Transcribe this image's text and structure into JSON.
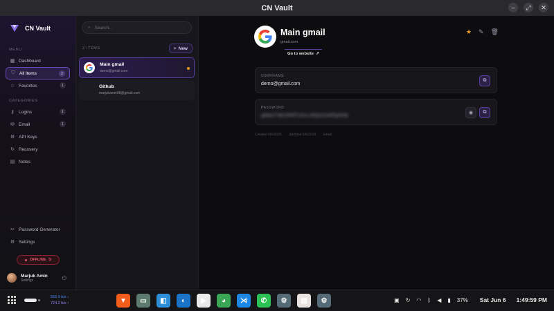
{
  "window": {
    "title": "CN Vault",
    "controls": [
      "–",
      "⤢",
      "✕"
    ]
  },
  "sidebar": {
    "brand": "CN Vault",
    "menu_label": "MENU",
    "menu": [
      {
        "label": "Dashboard",
        "icon": "dashboard-icon",
        "glyph": "▦",
        "count": ""
      },
      {
        "label": "All Items",
        "icon": "shield-icon",
        "glyph": "⛉",
        "count": "2"
      },
      {
        "label": "Favorites",
        "icon": "star-icon",
        "glyph": "☆",
        "count": "1"
      }
    ],
    "categories_label": "CATEGORIES",
    "categories": [
      {
        "label": "Logins",
        "icon": "key-icon",
        "glyph": "⚷",
        "count": "1"
      },
      {
        "label": "Email",
        "icon": "mail-icon",
        "glyph": "✉",
        "count": "1"
      },
      {
        "label": "API Keys",
        "icon": "api-icon",
        "glyph": "⚙",
        "count": ""
      },
      {
        "label": "Recovery",
        "icon": "recovery-icon",
        "glyph": "↻",
        "count": ""
      },
      {
        "label": "Notes",
        "icon": "note-icon",
        "glyph": "▤",
        "count": ""
      }
    ],
    "bottom": [
      {
        "label": "Password Generator",
        "icon": "tools-icon",
        "glyph": "✂"
      },
      {
        "label": "Settings",
        "icon": "gear-icon",
        "glyph": "⚙"
      }
    ],
    "status": "OFFLINE",
    "user": {
      "name": "Marjuk Amin",
      "sub": "Settings"
    }
  },
  "list": {
    "search_placeholder": "Search...",
    "count_label": "2 ITEMS",
    "new_label": "New",
    "items": [
      {
        "title": "Main gmail",
        "sub": "demo@gmail.com"
      },
      {
        "title": "Github",
        "sub": "marjukamin98@gmail.com"
      }
    ]
  },
  "detail": {
    "title": "Main gmail",
    "domain": "gmail.com",
    "goto_label": "Go to website",
    "username_label": "USERNAME",
    "username": "demo@gmail.com",
    "password_label": "PASSWORD",
    "password_masked": "gMail7!dK2f#9Tz4vLx8Qw2mR5pN3b",
    "created": "Created 6/6/2025",
    "updated": "Updated 6/6/2025",
    "category": "Email"
  },
  "taskbar": {
    "net_down": "555.9  b/s",
    "net_up": "724.2  b/s",
    "apps": [
      {
        "name": "brave-browser-icon",
        "color": "#f25d1c",
        "glyph": "▼"
      },
      {
        "name": "files-icon",
        "color": "#5d7a6e",
        "glyph": "▭"
      },
      {
        "name": "store-icon",
        "color": "#2e8fd8",
        "glyph": "◧"
      },
      {
        "name": "edge-browser-icon",
        "color": "#1a73c7",
        "glyph": "◐"
      },
      {
        "name": "play-store-icon",
        "color": "#eaeaea",
        "glyph": "▶"
      },
      {
        "name": "android-studio-icon",
        "color": "#3aa655",
        "glyph": "◕"
      },
      {
        "name": "vscode-icon",
        "color": "#1e88e5",
        "glyph": "⋊"
      },
      {
        "name": "whatsapp-icon",
        "color": "#2cc155",
        "glyph": "✆"
      },
      {
        "name": "app-settings-icon",
        "color": "#566b78",
        "glyph": "⚙"
      },
      {
        "name": "document-icon",
        "color": "#e8e2e0",
        "glyph": "▤"
      },
      {
        "name": "settings-app-icon",
        "color": "#566b78",
        "glyph": "⚙"
      }
    ],
    "battery": "37%",
    "date": "Sat Jun 6",
    "time": "1:49:59 PM"
  }
}
